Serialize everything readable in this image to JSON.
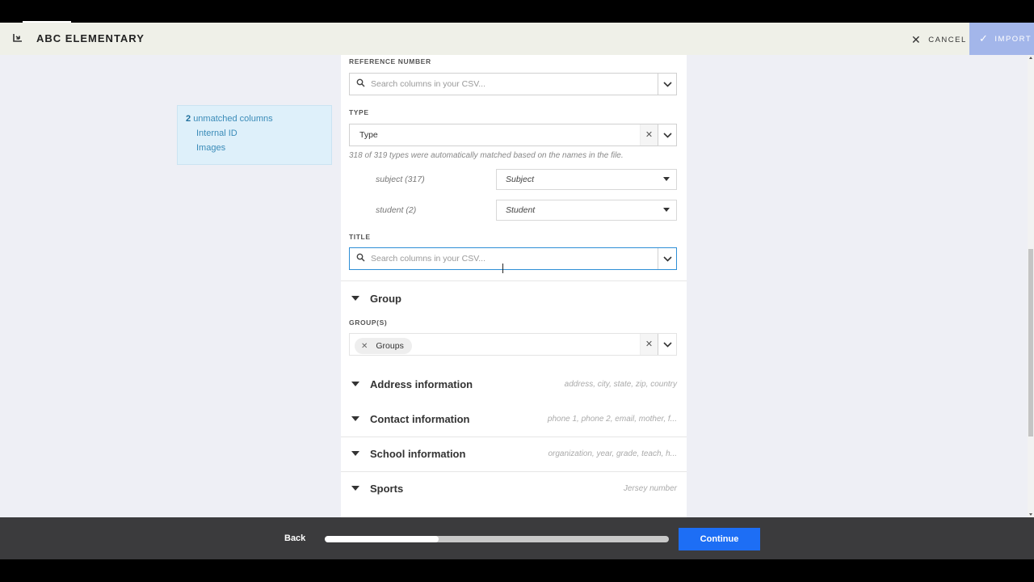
{
  "header": {
    "title": "ABC ELEMENTARY",
    "cancel_label": "CANCEL",
    "import_label": "IMPORT",
    "exit_icon": "exit-import-icon",
    "import_accent": "#a3b6ea"
  },
  "unmatched": {
    "count": "2",
    "label": "unmatched columns",
    "columns": [
      "Internal ID",
      "Images"
    ]
  },
  "fields": {
    "reference_number": {
      "label": "REFERENCE NUMBER",
      "placeholder": "Search columns in your CSV..."
    },
    "type": {
      "label": "TYPE",
      "value": "Type",
      "note": "318 of 319 types were automatically matched based on the names in the file.",
      "mappings": [
        {
          "source": "subject (317)",
          "target": "Subject"
        },
        {
          "source": "student (2)",
          "target": "Student"
        }
      ]
    },
    "title": {
      "label": "TITLE",
      "placeholder": "Search columns in your CSV..."
    }
  },
  "sections": {
    "group": {
      "title": "Group",
      "field_label": "GROUP(S)",
      "chip": "Groups"
    },
    "address": {
      "title": "Address information",
      "hint": "address, city, state, zip, country"
    },
    "contact": {
      "title": "Contact information",
      "hint": "phone 1, phone 2, email, mother, f..."
    },
    "school": {
      "title": "School information",
      "hint": "organization, year, grade, teach, h..."
    },
    "sports": {
      "title": "Sports",
      "hint": "Jersey number"
    }
  },
  "footer": {
    "back_label": "Back",
    "continue_label": "Continue",
    "progress": 0.33,
    "continue_color": "#1d6ef5"
  }
}
